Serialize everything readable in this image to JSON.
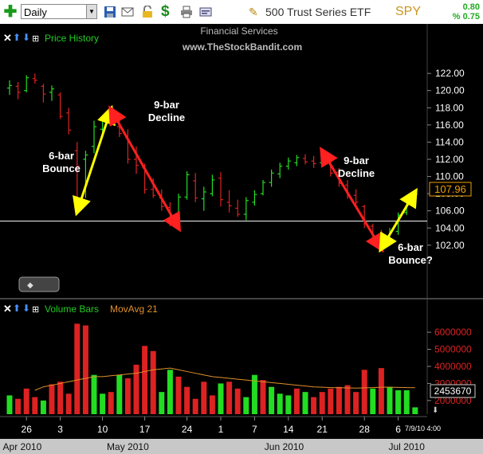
{
  "toolbar": {
    "period": "Daily",
    "symbol_name": "500 Trust Series ETF",
    "ticker": "SPY",
    "change": "0.80",
    "change_pct": "% 0.75"
  },
  "header": {
    "sector": "Financial Services",
    "website": "www.TheStockBandit.com"
  },
  "price_panel": {
    "title": "Price History",
    "last_price": "107.96",
    "colors": {
      "up": "#22dd22",
      "down": "#dd2222",
      "last_box": "#f0a000"
    }
  },
  "volume_panel": {
    "title": "Volume Bars",
    "ma_title": "MovAvg 21",
    "last_volume": "2453670"
  },
  "annotations": {
    "bounce1": [
      "6-bar",
      "Bounce"
    ],
    "decline1": [
      "9-bar",
      "Decline"
    ],
    "decline2": [
      "9-bar",
      "Decline"
    ],
    "bounce2": [
      "6-bar",
      "Bounce?"
    ]
  },
  "axis_date": "7/9/10 4:00",
  "chart_data": {
    "type": "bar",
    "title": "Price History",
    "subtitle": "Financial Services",
    "price_ticks": [
      102.0,
      104.0,
      106.0,
      108.0,
      110.0,
      112.0,
      114.0,
      116.0,
      118.0,
      120.0,
      122.0
    ],
    "ylim": [
      100.5,
      123.5
    ],
    "volume_ticks": [
      "2000000",
      "3000000",
      "4000000",
      "5000000",
      "6000000"
    ],
    "volume_ylim": [
      1200000,
      6800000
    ],
    "support_level": 104.8,
    "x_day_ticks": [
      {
        "i": 2,
        "label": "26"
      },
      {
        "i": 6,
        "label": "3"
      },
      {
        "i": 11,
        "label": "10"
      },
      {
        "i": 16,
        "label": "17"
      },
      {
        "i": 21,
        "label": "24"
      },
      {
        "i": 25,
        "label": "1"
      },
      {
        "i": 29,
        "label": "7"
      },
      {
        "i": 33,
        "label": "14"
      },
      {
        "i": 37,
        "label": "21"
      },
      {
        "i": 42,
        "label": "28"
      },
      {
        "i": 46,
        "label": "6"
      }
    ],
    "x_month_labels": [
      {
        "i": 1.5,
        "label": "Apr 2010"
      },
      {
        "i": 14,
        "label": "May 2010"
      },
      {
        "i": 32.5,
        "label": "Jun 2010"
      },
      {
        "i": 47,
        "label": "Jul 2010"
      }
    ],
    "price_bars": [
      {
        "o": 120.3,
        "h": 121.2,
        "l": 119.5,
        "c": 120.6
      },
      {
        "o": 120.5,
        "h": 121.0,
        "l": 119.0,
        "c": 119.8
      },
      {
        "o": 120.0,
        "h": 121.8,
        "l": 119.8,
        "c": 121.5
      },
      {
        "o": 121.4,
        "h": 122.0,
        "l": 120.8,
        "c": 121.2
      },
      {
        "o": 120.5,
        "h": 120.8,
        "l": 118.6,
        "c": 119.6
      },
      {
        "o": 119.8,
        "h": 120.6,
        "l": 118.8,
        "c": 120.2
      },
      {
        "o": 119.5,
        "h": 119.8,
        "l": 116.7,
        "c": 117.0
      },
      {
        "o": 117.4,
        "h": 118.0,
        "l": 114.9,
        "c": 115.4
      },
      {
        "o": 113.0,
        "h": 114.0,
        "l": 105.8,
        "c": 111.2
      },
      {
        "o": 112.0,
        "h": 113.0,
        "l": 107.5,
        "c": 112.5
      },
      {
        "o": 113.5,
        "h": 116.5,
        "l": 112.7,
        "c": 115.8
      },
      {
        "o": 115.5,
        "h": 117.0,
        "l": 115.0,
        "c": 116.5
      },
      {
        "o": 116.5,
        "h": 117.8,
        "l": 116.0,
        "c": 117.3
      },
      {
        "o": 115.8,
        "h": 116.5,
        "l": 114.6,
        "c": 115.0
      },
      {
        "o": 114.5,
        "h": 115.5,
        "l": 111.5,
        "c": 112.0
      },
      {
        "o": 112.0,
        "h": 113.5,
        "l": 110.3,
        "c": 111.3
      },
      {
        "o": 111.0,
        "h": 111.5,
        "l": 108.0,
        "c": 108.5
      },
      {
        "o": 108.5,
        "h": 109.8,
        "l": 107.5,
        "c": 107.8
      },
      {
        "o": 107.5,
        "h": 108.5,
        "l": 106.0,
        "c": 106.5
      },
      {
        "o": 106.4,
        "h": 107.0,
        "l": 104.2,
        "c": 104.8
      },
      {
        "o": 105.0,
        "h": 108.0,
        "l": 104.5,
        "c": 107.6
      },
      {
        "o": 107.6,
        "h": 110.6,
        "l": 107.3,
        "c": 110.2
      },
      {
        "o": 109.5,
        "h": 110.4,
        "l": 107.0,
        "c": 107.5
      },
      {
        "o": 107.4,
        "h": 108.8,
        "l": 106.0,
        "c": 108.2
      },
      {
        "o": 108.0,
        "h": 110.2,
        "l": 107.7,
        "c": 109.6
      },
      {
        "o": 109.8,
        "h": 110.5,
        "l": 106.5,
        "c": 107.3
      },
      {
        "o": 107.0,
        "h": 108.4,
        "l": 105.8,
        "c": 106.6
      },
      {
        "o": 106.3,
        "h": 107.3,
        "l": 105.3,
        "c": 105.6
      },
      {
        "o": 105.6,
        "h": 107.6,
        "l": 104.9,
        "c": 107.2
      },
      {
        "o": 107.0,
        "h": 108.4,
        "l": 106.6,
        "c": 107.9
      },
      {
        "o": 108.0,
        "h": 109.6,
        "l": 107.8,
        "c": 109.3
      },
      {
        "o": 109.3,
        "h": 110.8,
        "l": 108.8,
        "c": 110.4
      },
      {
        "o": 110.3,
        "h": 111.6,
        "l": 109.8,
        "c": 111.2
      },
      {
        "o": 111.2,
        "h": 112.2,
        "l": 110.8,
        "c": 111.8
      },
      {
        "o": 111.6,
        "h": 112.5,
        "l": 111.2,
        "c": 112.2
      },
      {
        "o": 112.1,
        "h": 112.6,
        "l": 111.4,
        "c": 111.7
      },
      {
        "o": 111.8,
        "h": 112.4,
        "l": 111.0,
        "c": 111.5
      },
      {
        "o": 111.6,
        "h": 113.0,
        "l": 111.3,
        "c": 112.6
      },
      {
        "o": 112.0,
        "h": 112.4,
        "l": 110.0,
        "c": 110.4
      },
      {
        "o": 110.5,
        "h": 111.0,
        "l": 108.8,
        "c": 109.2
      },
      {
        "o": 109.0,
        "h": 109.6,
        "l": 107.4,
        "c": 107.9
      },
      {
        "o": 107.8,
        "h": 108.5,
        "l": 106.5,
        "c": 107.0
      },
      {
        "o": 106.5,
        "h": 106.7,
        "l": 104.0,
        "c": 104.5
      },
      {
        "o": 104.2,
        "h": 104.5,
        "l": 102.3,
        "c": 102.8
      },
      {
        "o": 103.0,
        "h": 103.8,
        "l": 101.8,
        "c": 102.2
      },
      {
        "o": 102.5,
        "h": 104.0,
        "l": 102.1,
        "c": 103.5
      },
      {
        "o": 103.6,
        "h": 105.8,
        "l": 103.2,
        "c": 105.5
      },
      {
        "o": 105.8,
        "h": 107.5,
        "l": 105.5,
        "c": 107.0
      },
      {
        "o": 107.2,
        "h": 108.2,
        "l": 107.0,
        "c": 107.96
      }
    ],
    "volume_bars": [
      {
        "v": 2300000,
        "up": true
      },
      {
        "v": 2100000,
        "up": false
      },
      {
        "v": 2700000,
        "up": false
      },
      {
        "v": 2200000,
        "up": false
      },
      {
        "v": 2000000,
        "up": true
      },
      {
        "v": 2950000,
        "up": false
      },
      {
        "v": 3100000,
        "up": false
      },
      {
        "v": 2400000,
        "up": false
      },
      {
        "v": 6500000,
        "up": false
      },
      {
        "v": 6400000,
        "up": false
      },
      {
        "v": 3500000,
        "up": true
      },
      {
        "v": 2400000,
        "up": true
      },
      {
        "v": 2500000,
        "up": false
      },
      {
        "v": 3500000,
        "up": true
      },
      {
        "v": 3300000,
        "up": false
      },
      {
        "v": 4100000,
        "up": false
      },
      {
        "v": 5200000,
        "up": false
      },
      {
        "v": 4900000,
        "up": false
      },
      {
        "v": 2500000,
        "up": true
      },
      {
        "v": 3800000,
        "up": true
      },
      {
        "v": 3400000,
        "up": false
      },
      {
        "v": 2800000,
        "up": false
      },
      {
        "v": 2100000,
        "up": false
      },
      {
        "v": 3100000,
        "up": false
      },
      {
        "v": 2300000,
        "up": false
      },
      {
        "v": 3000000,
        "up": true
      },
      {
        "v": 3100000,
        "up": false
      },
      {
        "v": 2700000,
        "up": false
      },
      {
        "v": 2200000,
        "up": true
      },
      {
        "v": 3500000,
        "up": true
      },
      {
        "v": 3200000,
        "up": false
      },
      {
        "v": 2800000,
        "up": true
      },
      {
        "v": 2400000,
        "up": true
      },
      {
        "v": 2300000,
        "up": true
      },
      {
        "v": 2700000,
        "up": false
      },
      {
        "v": 2500000,
        "up": true
      },
      {
        "v": 2200000,
        "up": false
      },
      {
        "v": 2500000,
        "up": false
      },
      {
        "v": 2700000,
        "up": false
      },
      {
        "v": 2800000,
        "up": false
      },
      {
        "v": 2900000,
        "up": false
      },
      {
        "v": 2500000,
        "up": false
      },
      {
        "v": 3800000,
        "up": false
      },
      {
        "v": 2700000,
        "up": true
      },
      {
        "v": 3900000,
        "up": false
      },
      {
        "v": 2800000,
        "up": true
      },
      {
        "v": 2600000,
        "up": true
      },
      {
        "v": 2600000,
        "up": true
      },
      {
        "v": 1600000,
        "up": true
      }
    ],
    "volume_ma": [
      null,
      null,
      null,
      2600000,
      2800000,
      2900000,
      3000000,
      3100000,
      3200000,
      3300000,
      3400000,
      3400000,
      3450000,
      3500000,
      3550000,
      3600000,
      3700000,
      3800000,
      3850000,
      3900000,
      3800000,
      3700000,
      3600000,
      3500000,
      3400000,
      3350000,
      3300000,
      3250000,
      3200000,
      3150000,
      3100000,
      3050000,
      3000000,
      2950000,
      2900000,
      2850000,
      2800000,
      2780000,
      2760000,
      2750000,
      2740000,
      2730000,
      2740000,
      2760000,
      2780000,
      2780000,
      2770000,
      2760000,
      2750000
    ],
    "arrows": [
      {
        "from": [
          8,
          105.9
        ],
        "to": [
          12,
          117.8
        ],
        "color": "#ffff00"
      },
      {
        "from": [
          12,
          117.8
        ],
        "to": [
          20,
          104.0
        ],
        "color": "#ff2020"
      },
      {
        "from": [
          37,
          113.0
        ],
        "to": [
          44,
          101.6
        ],
        "color": "#ff2020"
      },
      {
        "from": [
          44,
          101.6
        ],
        "to": [
          48,
          108.2
        ],
        "color": "#ffff00"
      }
    ]
  }
}
